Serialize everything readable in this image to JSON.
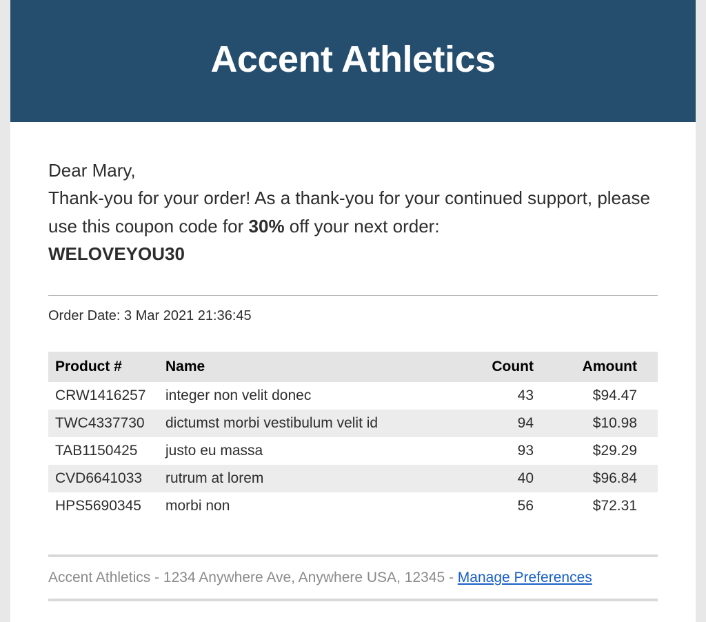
{
  "header": {
    "title": "Accent Athletics"
  },
  "greeting": {
    "salutation": "Dear Mary,",
    "line1_pre": "Thank-you for your order! As a thank-you for your continued support, please use this coupon code for ",
    "discount": "30%",
    "line1_post": " off your next order:",
    "coupon": "WELOVEYOU30"
  },
  "order": {
    "date_label": "Order Date: ",
    "date_value": "3 Mar 2021 21:36:45",
    "columns": {
      "product": "Product #",
      "name": "Name",
      "count": "Count",
      "amount": "Amount"
    },
    "rows": [
      {
        "product": "CRW1416257",
        "name": "integer non velit donec",
        "count": "43",
        "amount": "$94.47"
      },
      {
        "product": "TWC4337730",
        "name": "dictumst morbi vestibulum velit id",
        "count": "94",
        "amount": "$10.98"
      },
      {
        "product": "TAB1150425",
        "name": "justo eu massa",
        "count": "93",
        "amount": "$29.29"
      },
      {
        "product": "CVD6641033",
        "name": "rutrum at lorem",
        "count": "40",
        "amount": "$96.84"
      },
      {
        "product": "HPS5690345",
        "name": "morbi non",
        "count": "56",
        "amount": "$72.31"
      }
    ]
  },
  "footer": {
    "text": "Accent Athletics - 1234 Anywhere Ave, Anywhere USA, 12345 - ",
    "link": "Manage Preferences"
  }
}
